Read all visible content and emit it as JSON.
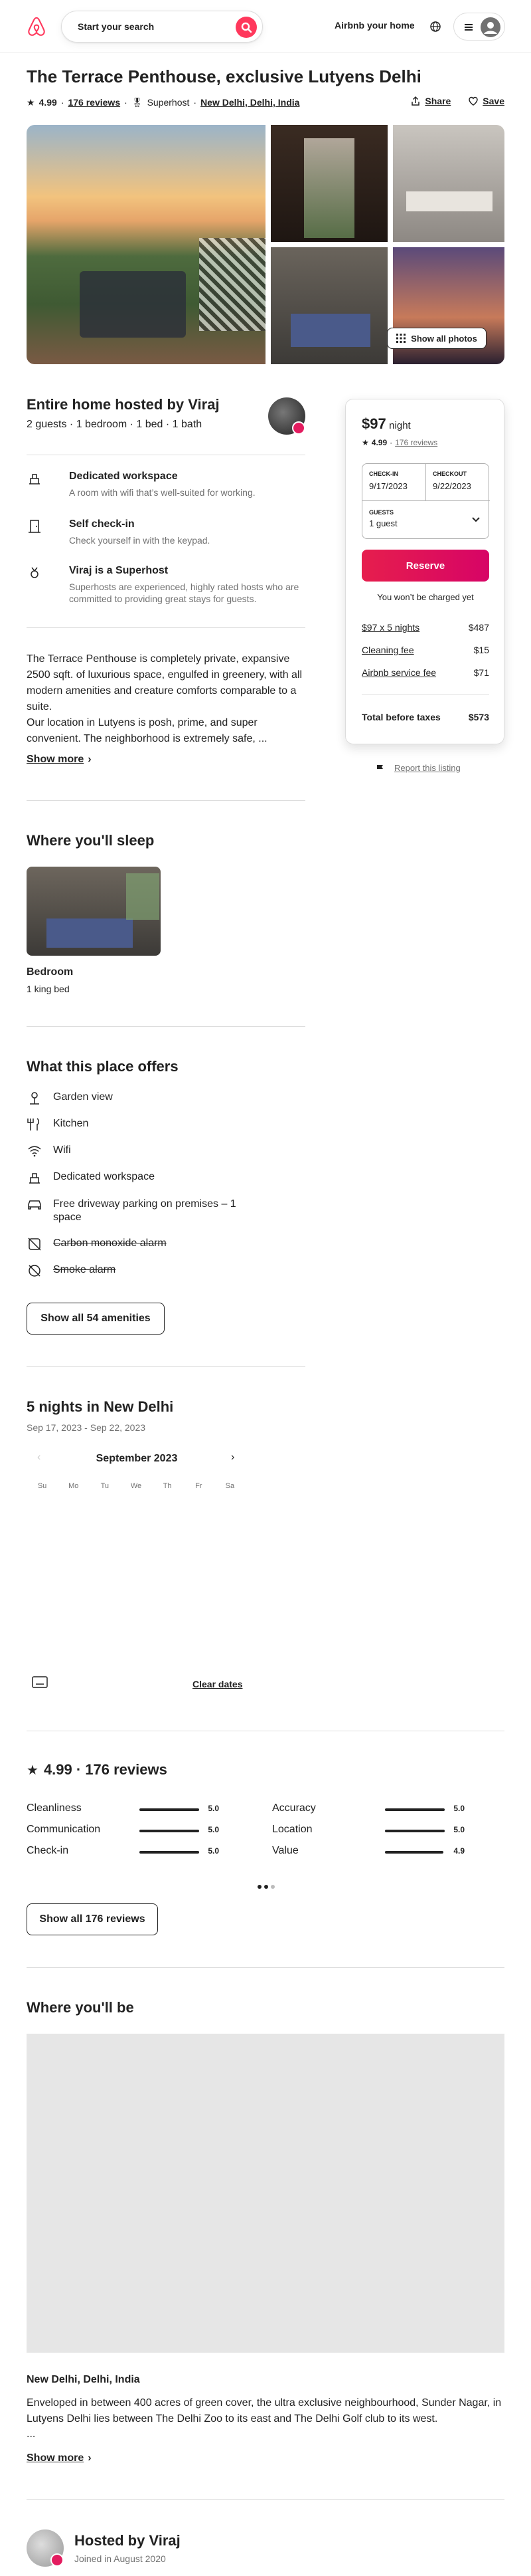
{
  "header": {
    "search_label": "Start your search",
    "host_link": "Airbnb your home"
  },
  "listing": {
    "title": "The Terrace Penthouse, exclusive Lutyens Delhi",
    "rating": "4.99",
    "reviews_link": "176 reviews",
    "superhost": "Superhost",
    "location": "New Delhi, Delhi, India",
    "share": "Share",
    "save": "Save",
    "show_all_photos": "Show all photos"
  },
  "overview": {
    "heading": "Entire home hosted by Viraj",
    "details": "2 guests · 1 bedroom · 1 bed · 1 bath",
    "features": [
      {
        "title": "Dedicated workspace",
        "desc": "A room with wifi that’s well-suited for working."
      },
      {
        "title": "Self check-in",
        "desc": "Check yourself in with the keypad."
      },
      {
        "title": "Viraj is a Superhost",
        "desc": "Superhosts are experienced, highly rated hosts who are committed to providing great stays for guests."
      }
    ],
    "description_1": "The Terrace Penthouse is completely private, expansive 2500 sqft. of luxurious space, engulfed in greenery, with all modern amenities and creature comforts comparable to a suite.",
    "description_2": "Our location in Lutyens is posh, prime, and super convenient. The neighborhood is extremely safe, ...",
    "show_more": "Show more"
  },
  "booking": {
    "price": "$97",
    "per": "night",
    "rating": "4.99",
    "reviews": "176 reviews",
    "checkin_label": "CHECK-IN",
    "checkin_value": "9/17/2023",
    "checkout_label": "CHECKOUT",
    "checkout_value": "9/22/2023",
    "guests_label": "GUESTS",
    "guests_value": "1 guest",
    "reserve": "Reserve",
    "no_charge": "You won’t be charged yet",
    "lines": [
      {
        "label": "$97 x 5 nights",
        "value": "$487"
      },
      {
        "label": "Cleaning fee",
        "value": "$15"
      },
      {
        "label": "Airbnb service fee",
        "value": "$71"
      }
    ],
    "total_label": "Total before taxes",
    "total_value": "$573",
    "report": "Report this listing"
  },
  "sleep": {
    "heading": "Where you'll sleep",
    "room": "Bedroom",
    "bed": "1 king bed"
  },
  "amenities": {
    "heading": "What this place offers",
    "items": [
      {
        "label": "Garden view",
        "icon": "garden-view-icon"
      },
      {
        "label": "Kitchen",
        "icon": "kitchen-icon"
      },
      {
        "label": "Wifi",
        "icon": "wifi-icon"
      },
      {
        "label": "Dedicated workspace",
        "icon": "workspace-icon"
      },
      {
        "label": "Free driveway parking on premises – 1 space",
        "icon": "car-icon"
      },
      {
        "label": "Carbon monoxide alarm",
        "icon": "co-alarm-off-icon"
      },
      {
        "label": "Smoke alarm",
        "icon": "smoke-alarm-off-icon"
      }
    ],
    "button": "Show all 54 amenities"
  },
  "calendar": {
    "heading": "5 nights in New Delhi",
    "range": "Sep 17, 2023 - Sep 22, 2023",
    "month": "September 2023",
    "weekdays": [
      "Su",
      "Mo",
      "Tu",
      "We",
      "Th",
      "Fr",
      "Sa"
    ],
    "clear": "Clear dates"
  },
  "reviews": {
    "heading": "4.99 · 176 reviews",
    "categories": [
      {
        "label": "Cleanliness",
        "value": "5.0",
        "fraction": 1.0
      },
      {
        "label": "Accuracy",
        "value": "5.0",
        "fraction": 1.0
      },
      {
        "label": "Communication",
        "value": "5.0",
        "fraction": 1.0
      },
      {
        "label": "Location",
        "value": "5.0",
        "fraction": 1.0
      },
      {
        "label": "Check-in",
        "value": "5.0",
        "fraction": 1.0
      },
      {
        "label": "Value",
        "value": "4.9",
        "fraction": 0.98
      }
    ],
    "button": "Show all 176 reviews"
  },
  "location": {
    "heading": "Where you'll be",
    "place": "New Delhi, Delhi, India",
    "desc": "Enveloped in between 400 acres of green cover, the ultra exclusive neighbourhood, Sunder Nagar, in Lutyens Delhi lies between The Delhi Zoo to its east and The Delhi Golf club to its west.",
    "ellipsis": "...",
    "show_more": "Show more"
  },
  "host": {
    "heading": "Hosted by Viraj",
    "joined": "Joined in August 2020"
  },
  "colors": {
    "brand": "#ff385c",
    "reserve": "#e31c5f"
  }
}
